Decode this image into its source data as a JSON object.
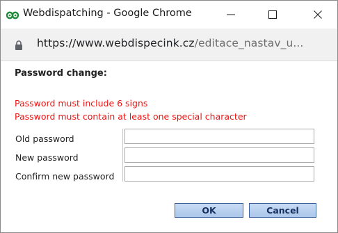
{
  "window": {
    "title": "Webdispatching - Google Chrome",
    "icon": "green-infinity-logo-icon",
    "controls": {
      "minimize": "minimize-icon",
      "maximize": "maximize-icon",
      "close": "close-icon"
    }
  },
  "address_bar": {
    "icon": "lock-icon",
    "url_main": "https://www.webdispecink.cz",
    "url_rest": "/editace_nastav_u..."
  },
  "form": {
    "heading": "Password change:",
    "errors": [
      "Password must include 6 signs",
      "Password must contain at least one special character"
    ],
    "fields": [
      {
        "label": "Old password",
        "value": ""
      },
      {
        "label": "New password",
        "value": ""
      },
      {
        "label": "Confirm new password",
        "value": ""
      }
    ],
    "buttons": {
      "ok": "OK",
      "cancel": "Cancel"
    }
  },
  "colors": {
    "error": "#ee1111",
    "button_bg": "#b8d0ef",
    "button_border": "#3a5f9a",
    "logo": "#1e8a3a"
  }
}
